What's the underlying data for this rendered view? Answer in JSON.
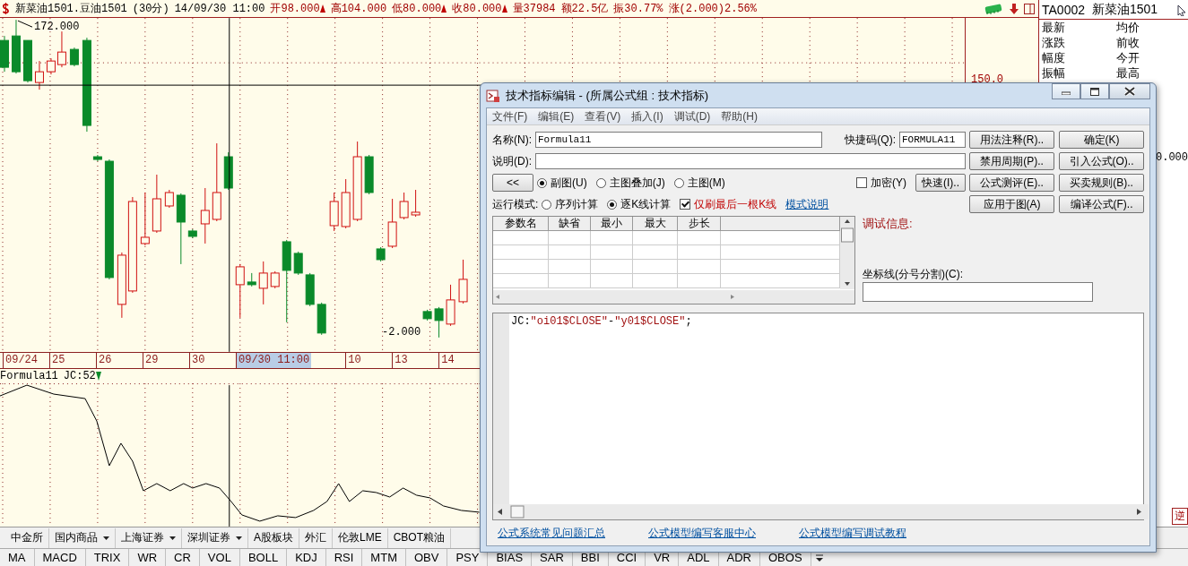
{
  "quote_header": {
    "title": "新菜油1501.豆油1501",
    "period": "(30分)",
    "datetime": "14/09/30 11:00",
    "fields": [
      {
        "text": "开98.000",
        "marker": true
      },
      {
        "text": "高104.000",
        "marker": false
      },
      {
        "text": "低80.000",
        "marker": true
      },
      {
        "text": "收80.000",
        "marker": true
      },
      {
        "text": "量37984",
        "marker": false
      },
      {
        "text": "额22.5亿",
        "marker": false
      },
      {
        "text": "振30.77%",
        "marker": false
      },
      {
        "text": "涨(2.000)2.56%",
        "marker": false
      }
    ]
  },
  "price_chart": {
    "high_label": "172.000",
    "low_label": "-2.000",
    "axis_label": "150.0"
  },
  "date_axis": [
    {
      "label": "09/24",
      "selected": false
    },
    {
      "label": "25",
      "selected": false
    },
    {
      "label": "26",
      "selected": false
    },
    {
      "label": "29",
      "selected": false
    },
    {
      "label": "30",
      "selected": false
    },
    {
      "label": "09/30 11:00",
      "selected": true
    },
    {
      "label": "10",
      "selected": false
    },
    {
      "label": "13",
      "selected": false
    },
    {
      "label": "14",
      "selected": false
    }
  ],
  "indicator": {
    "name": "Formula11",
    "value": "JC:52"
  },
  "quote_panel": {
    "code": "TA0002",
    "name": "新菜油1501",
    "rows": [
      [
        "最新",
        "均价"
      ],
      [
        "涨跌",
        "前收"
      ],
      [
        "幅度",
        "今开"
      ],
      [
        "振幅",
        "最高"
      ]
    ],
    "edge_value": "0.000",
    "edge_text": "逆"
  },
  "dialog": {
    "title": "技术指标编辑 - (所属公式组 : 技术指标)",
    "menu": [
      "文件(F)",
      "编辑(E)",
      "查看(V)",
      "插入(I)",
      "调试(D)",
      "帮助(H)"
    ],
    "name_label": "名称(N):",
    "name_value": "Formula11",
    "shortcut_label": "快捷码(Q):",
    "shortcut_value": "FORMULA11",
    "desc_label": "说明(D):",
    "collapse_button": "<<",
    "position_options": [
      {
        "label": "副图(U)",
        "selected": true
      },
      {
        "label": "主图叠加(J)",
        "selected": false
      },
      {
        "label": "主图(M)",
        "selected": false
      }
    ],
    "encrypt": {
      "label": "加密(Y)",
      "checked": false
    },
    "quick_button": "快速(I)..",
    "run_mode_label": "运行模式:",
    "run_modes": [
      {
        "label": "序列计算",
        "selected": false
      },
      {
        "label": "逐K线计算",
        "selected": true
      }
    ],
    "refresh_last": {
      "label": "仅刷最后一根K线",
      "checked": true
    },
    "mode_help_link": "模式说明",
    "side_buttons": [
      "用法注释(R)..",
      "确定(K)",
      "禁用周期(P)..",
      "引入公式(O)..",
      "公式测评(E)..",
      "买卖规则(B)..",
      "应用于图(A)",
      "编译公式(F).."
    ],
    "param_columns": [
      "参数名",
      "缺省",
      "最小",
      "最大",
      "步长"
    ],
    "debug_label": "调试信息:",
    "axis_label": "坐标线(分号分割)(C):",
    "code_line": [
      {
        "text": "JC:",
        "kind": "plain"
      },
      {
        "text": "\"oi01$CLOSE\"",
        "kind": "string"
      },
      {
        "text": "-",
        "kind": "plain"
      },
      {
        "text": "\"y01$CLOSE\"",
        "kind": "string"
      },
      {
        "text": ";",
        "kind": "plain"
      }
    ],
    "footer_links": [
      "公式系统常见问题汇总",
      "公式模型编写客服中心",
      "公式模型编写调试教程"
    ]
  },
  "market_tabs": [
    {
      "label": "中金所",
      "dropdown": false
    },
    {
      "label": "国内商品",
      "dropdown": true
    },
    {
      "label": "上海证券",
      "dropdown": true
    },
    {
      "label": "深圳证券",
      "dropdown": true
    },
    {
      "label": "A股板块",
      "dropdown": false
    },
    {
      "label": "外汇",
      "dropdown": false
    },
    {
      "label": "伦敦LME",
      "dropdown": false
    },
    {
      "label": "CBOT粮油",
      "dropdown": false
    }
  ],
  "indicator_tabs": [
    "MA",
    "MACD",
    "TRIX",
    "WR",
    "CR",
    "VOL",
    "BOLL",
    "KDJ",
    "RSI",
    "MTM",
    "OBV",
    "PSY",
    "BIAS",
    "SAR",
    "BBI",
    "CCI",
    "VR",
    "ADL",
    "ADR",
    "OBOS"
  ]
}
